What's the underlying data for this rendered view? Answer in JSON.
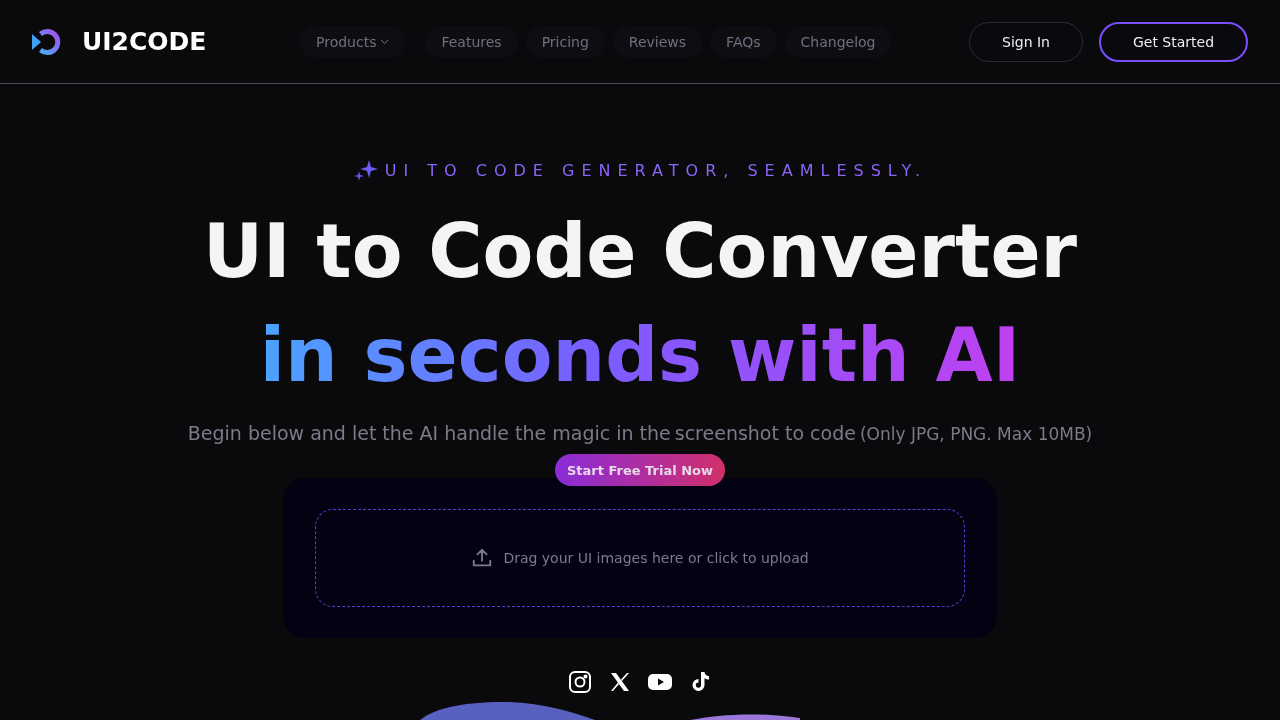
{
  "header": {
    "brand": "UI2CODE",
    "nav": [
      {
        "label": "Products",
        "dropdown": true
      },
      {
        "label": "Features",
        "dropdown": false
      },
      {
        "label": "Pricing",
        "dropdown": false
      },
      {
        "label": "Reviews",
        "dropdown": false
      },
      {
        "label": "FAQs",
        "dropdown": false
      },
      {
        "label": "Changelog",
        "dropdown": false
      }
    ],
    "sign_in": "Sign In",
    "get_started": "Get Started"
  },
  "hero": {
    "eyebrow": "UI TO CODE GENERATOR, SEAMLESSLY.",
    "title": "UI to Code Converter",
    "subtitle": "in seconds with AI",
    "description": "Begin below and let the AI handle the magic in the",
    "link": "screenshot to code",
    "note": "(Only JPG, PNG. Max 10MB)",
    "trial_badge": "Start Free Trial Now",
    "upload": "Drag your UI images here or click to upload"
  },
  "social": [
    {
      "kind": "instagram"
    },
    {
      "kind": "x"
    },
    {
      "kind": "youtube"
    },
    {
      "kind": "tiktok"
    }
  ]
}
